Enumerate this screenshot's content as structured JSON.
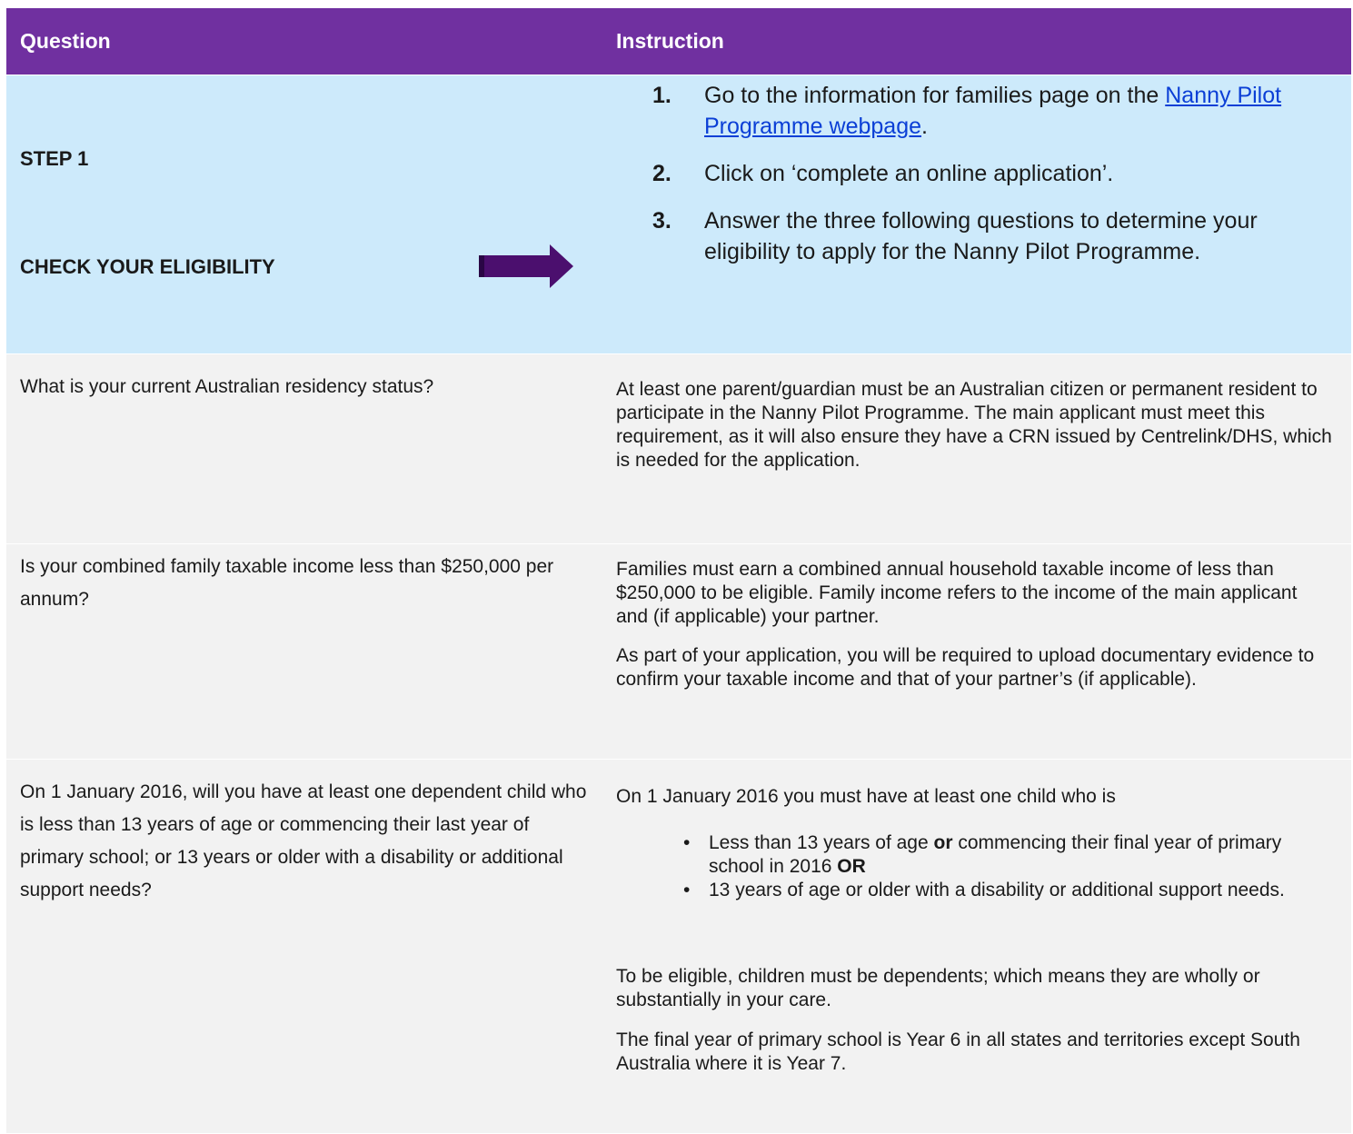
{
  "header": {
    "question": "Question",
    "instruction": "Instruction"
  },
  "step1": {
    "label": "STEP 1",
    "title": "CHECK YOUR ELIGIBILITY",
    "items": [
      {
        "num": "1.",
        "pre": "Go to the information for families page on the ",
        "link": "Nanny Pilot Programme webpage",
        "post": "."
      },
      {
        "num": "2.",
        "text": "Click on ‘complete an online application’."
      },
      {
        "num": "3.",
        "text": "Answer the three following questions to determine your eligibility to apply for the Nanny Pilot Programme."
      }
    ]
  },
  "rows": [
    {
      "question": "What is your current Australian residency status?",
      "paragraphs": [
        "At least one parent/guardian must be an Australian citizen or permanent resident to participate in the Nanny Pilot Programme. The main applicant must meet this requirement, as it will also ensure they have a CRN issued by Centrelink/DHS, which is needed for the application."
      ]
    },
    {
      "question": "Is your combined family taxable income less than $250,000 per annum?",
      "paragraphs": [
        "Families must earn a combined annual household taxable income of less than $250,000 to be eligible. Family income refers to the income of the main applicant and (if applicable) your partner.",
        "As part of your application, you will be required to upload documentary evidence to confirm your taxable income and that of your partner’s (if applicable)."
      ]
    },
    {
      "question": "On 1 January 2016, will you have at least one dependent child who is less than 13 years of age or commencing their last year of primary school; or 13 years or older with a disability or additional support needs?",
      "intro": "On 1 January 2016 you must have at least one child who is",
      "bullets": [
        {
          "a": "Less than 13 years of age ",
          "b1": "or",
          "c": " commencing their final year of primary school in 2016 ",
          "b2": "OR"
        },
        {
          "text": "13 years of age or older with a disability or additional support needs."
        }
      ],
      "paragraphs": [
        "To be eligible, children must be dependents; which means they are wholly or substantially in your care.",
        "The final year of primary school is Year 6 in all states and territories except South Australia where it is Year 7."
      ]
    }
  ],
  "colors": {
    "header_bg": "#7030a0",
    "step_bg": "#cdeafb",
    "row_bg": "#f2f2f2",
    "arrow": "#4b0f6e",
    "link": "#0b3fd6"
  },
  "icons": {
    "arrow": "right-arrow-icon",
    "bullet": "•"
  }
}
